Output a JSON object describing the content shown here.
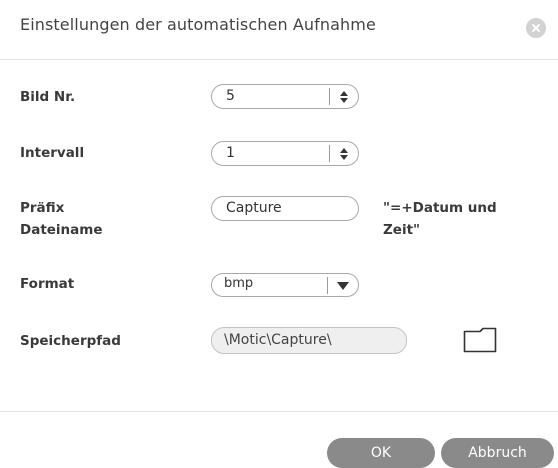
{
  "dialog": {
    "title": "Einstellungen der automatischen Aufnahme",
    "close_icon": "close-circle-icon"
  },
  "form": {
    "image_number": {
      "label": "Bild Nr.",
      "value": "5"
    },
    "interval": {
      "label": "Intervall",
      "value": "1"
    },
    "filename_prefix": {
      "label_line1": "Präfix",
      "label_line2": "Dateiname",
      "value": "Capture",
      "note_line1": "\"=+Datum und",
      "note_line2": "Zeit\""
    },
    "format": {
      "label": "Format",
      "value": "bmp",
      "options": [
        "bmp"
      ]
    },
    "save_path": {
      "label": "Speicherpfad",
      "value": "\\Motic\\Capture\\",
      "browse_icon": "folder-icon"
    }
  },
  "buttons": {
    "ok": "OK",
    "cancel": "Abbruch"
  },
  "colors": {
    "button_bg": "#8a8a8a",
    "field_border": "#a9a9a9",
    "readonly_bg": "#efefef"
  }
}
